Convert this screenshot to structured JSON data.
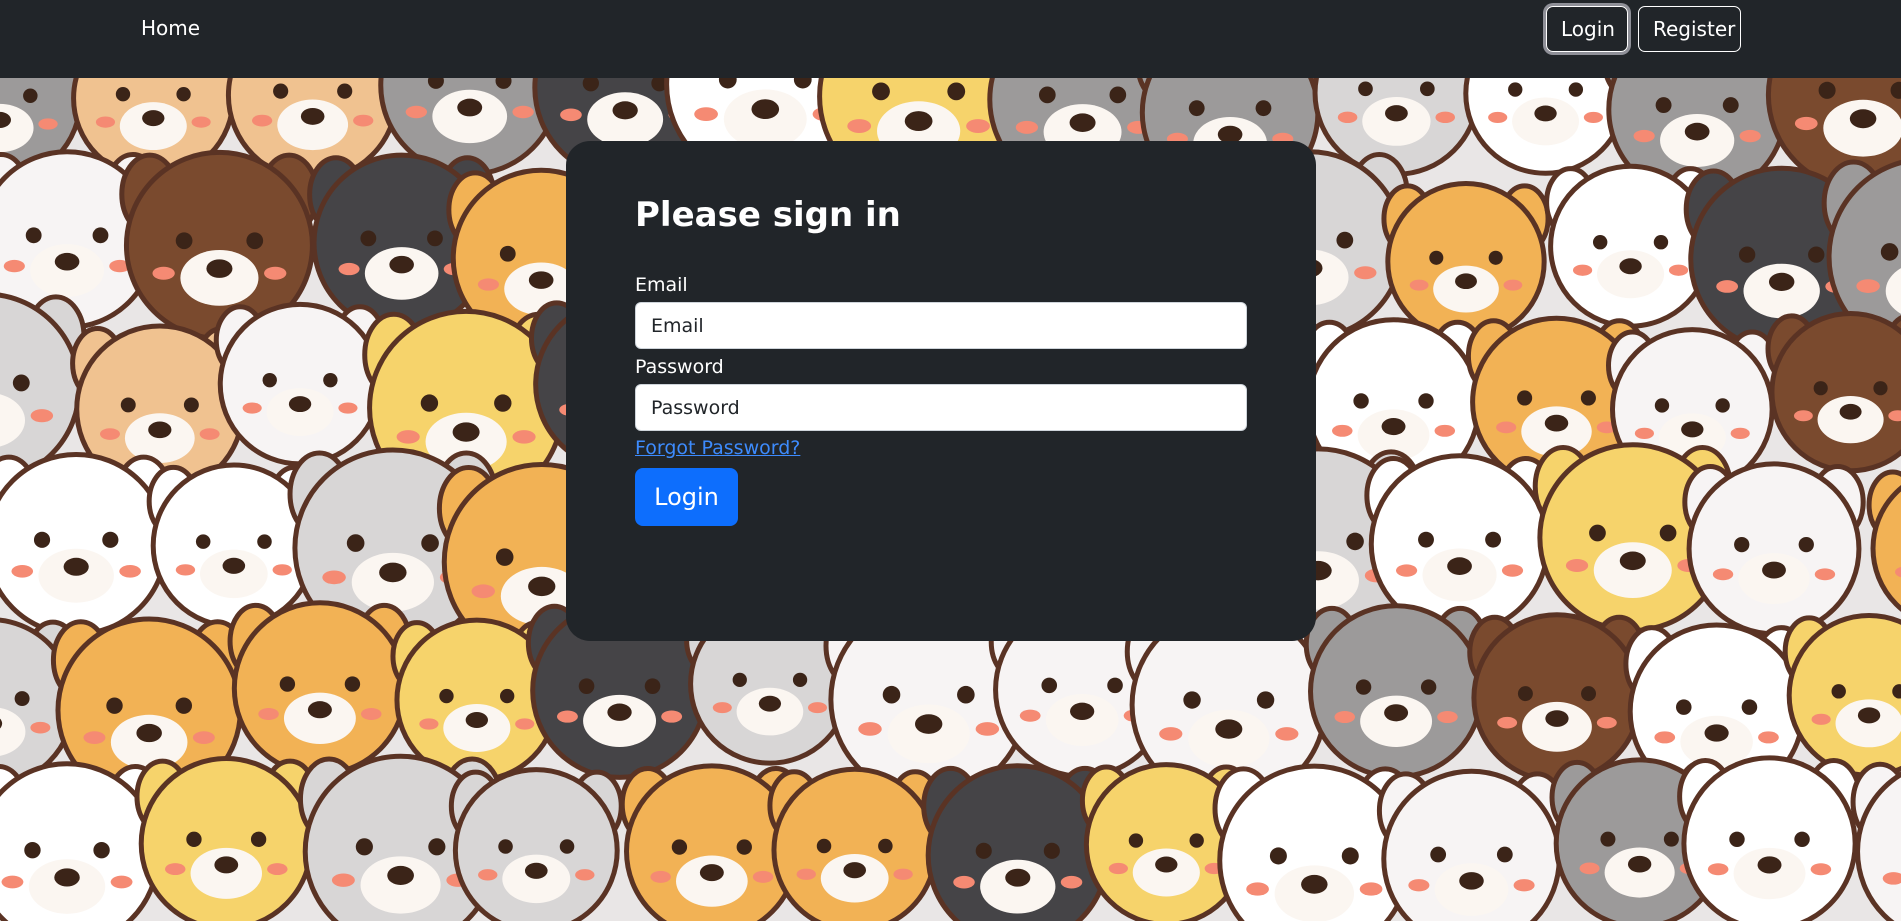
{
  "nav": {
    "home_label": "Home",
    "login_label": "Login",
    "register_label": "Register"
  },
  "login_card": {
    "title": "Please sign in",
    "email_label": "Email",
    "email_placeholder": "Email",
    "email_value": "",
    "password_label": "Password",
    "password_placeholder": "Password",
    "password_value": "",
    "forgot_label": "Forgot Password?",
    "submit_label": "Login"
  },
  "colors": {
    "navbar": "#212529",
    "card": "#212529",
    "primary": "#0d6efd",
    "link": "#3d8bfd"
  },
  "background": {
    "icon": "cartoon-dog-pattern"
  }
}
